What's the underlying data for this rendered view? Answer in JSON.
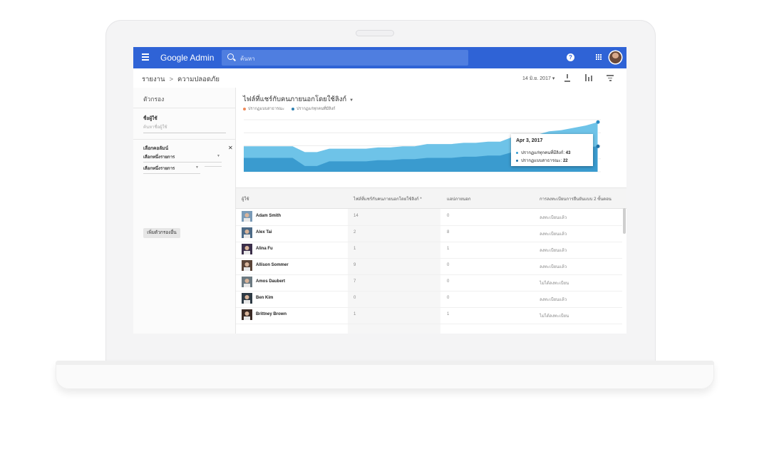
{
  "app": {
    "brand": "Google Admin",
    "search_placeholder": "ค้นหา"
  },
  "icons": {
    "menu": "hamburger-menu-icon",
    "search": "search-icon",
    "help": "help-icon",
    "apps": "apps-grid-icon",
    "account": "account-avatar",
    "download": "download-icon",
    "columns": "manage-columns-icon",
    "filter": "filter-icon"
  },
  "breadcrumb": {
    "root": "รายงาน",
    "separator": ">",
    "current": "ความปลอดภัย"
  },
  "toolbar": {
    "date": "14 มิ.ย. 2017"
  },
  "filters": {
    "title": "ตัวกรอง",
    "username_label": "ชื่อผู้ใช้",
    "username_placeholder": "ค้นหาชื่อผู้ใช้",
    "column_label": "เลือกคอลัมน์",
    "select1": "เลือกหนึ่งรายการ",
    "select2": "เลือกหนึ่งรายการ",
    "add_button": "เพิ่มตัวกรองอื่น"
  },
  "chart_data": {
    "type": "area",
    "title": "ไฟล์ที่แชร์กับคนภายนอกโดยใช้ลิงก์",
    "series": [
      {
        "name": "ปรากฏแบบสาธารณะ",
        "color": "#ef8a5a",
        "values": [
          12,
          12,
          12,
          12,
          12,
          5,
          5,
          9,
          9,
          9,
          9,
          10,
          10,
          11,
          11,
          12,
          12,
          12,
          13,
          13,
          14,
          14,
          17,
          18,
          19,
          20,
          20,
          20,
          21,
          22
        ]
      },
      {
        "name": "ปรากฏแก่ทุกคนที่มีลิงก์",
        "color": "#3a9bcf",
        "values": [
          22,
          22,
          22,
          22,
          22,
          17,
          17,
          20,
          20,
          20,
          20,
          21,
          21,
          22,
          22,
          24,
          24,
          24,
          25,
          25,
          26,
          26,
          30,
          31,
          32,
          35,
          36,
          38,
          40,
          43
        ]
      }
    ],
    "ylim": [
      0,
      45
    ]
  },
  "tooltip": {
    "date": "Apr 3, 2017",
    "row1_label": "ปรากฏแก่ทุกคนที่มีลิงก์:",
    "row1_value": "43",
    "row2_label": "ปรากฏแบบสาธารณะ:",
    "row2_value": "22"
  },
  "table": {
    "headers": [
      "ผู้ใช้",
      "ไฟล์ที่แชร์กับคนภายนอกโดยใช้ลิงก์",
      "แอปภายนอก",
      "การลงทะเบียนการยืนยันแบบ 2 ขั้นตอน"
    ],
    "sort_indicator": "*",
    "rows": [
      {
        "name": "Adam Smith",
        "links": "14",
        "apps": "0",
        "twosv": "ลงทะเบียนแล้ว"
      },
      {
        "name": "Alex Tai",
        "links": "2",
        "apps": "8",
        "twosv": "ลงทะเบียนแล้ว"
      },
      {
        "name": "Alina Fu",
        "links": "1",
        "apps": "1",
        "twosv": "ลงทะเบียนแล้ว"
      },
      {
        "name": "Allison Sommer",
        "links": "9",
        "apps": "0",
        "twosv": "ลงทะเบียนแล้ว"
      },
      {
        "name": "Amos Daubert",
        "links": "7",
        "apps": "0",
        "twosv": "ไม่ได้ลงทะเบียน"
      },
      {
        "name": "Ben Kim",
        "links": "0",
        "apps": "0",
        "twosv": "ลงทะเบียนแล้ว"
      },
      {
        "name": "Brittney Brown",
        "links": "1",
        "apps": "1",
        "twosv": "ไม่ได้ลงทะเบียน"
      }
    ]
  },
  "colors": {
    "topbar": "#2f63d6",
    "area_light": "#6ec3e8",
    "area_dark": "#3a9bcf",
    "public_dot": "#ef8a5a"
  }
}
